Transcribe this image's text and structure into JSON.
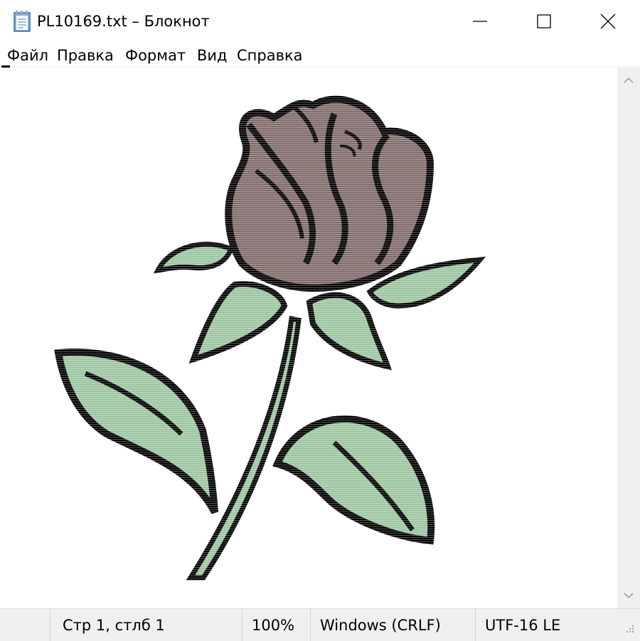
{
  "window": {
    "title": "PL10169.txt – Блокнот"
  },
  "icons": {
    "app": "notepad-icon",
    "minimize": "minimize-icon",
    "maximize": "maximize-icon",
    "close": "close-icon",
    "scroll_up": "chevron-up-icon",
    "scroll_down": "chevron-down-icon",
    "resize_grip": "resize-grip-icon"
  },
  "menu": {
    "items": [
      {
        "label": "Файл"
      },
      {
        "label": "Правка"
      },
      {
        "label": "Формат"
      },
      {
        "label": "Вид"
      },
      {
        "label": "Справка"
      }
    ]
  },
  "status": {
    "position": "Стр 1, стлб 1",
    "zoom": "100%",
    "line_endings": "Windows (CRLF)",
    "encoding": "UTF-16 LE"
  },
  "colors": {
    "petal_fill": "#806a6a",
    "leaf_fill": "#9cc59f",
    "outline": "#000000",
    "chrome": "#f0f0f0"
  }
}
